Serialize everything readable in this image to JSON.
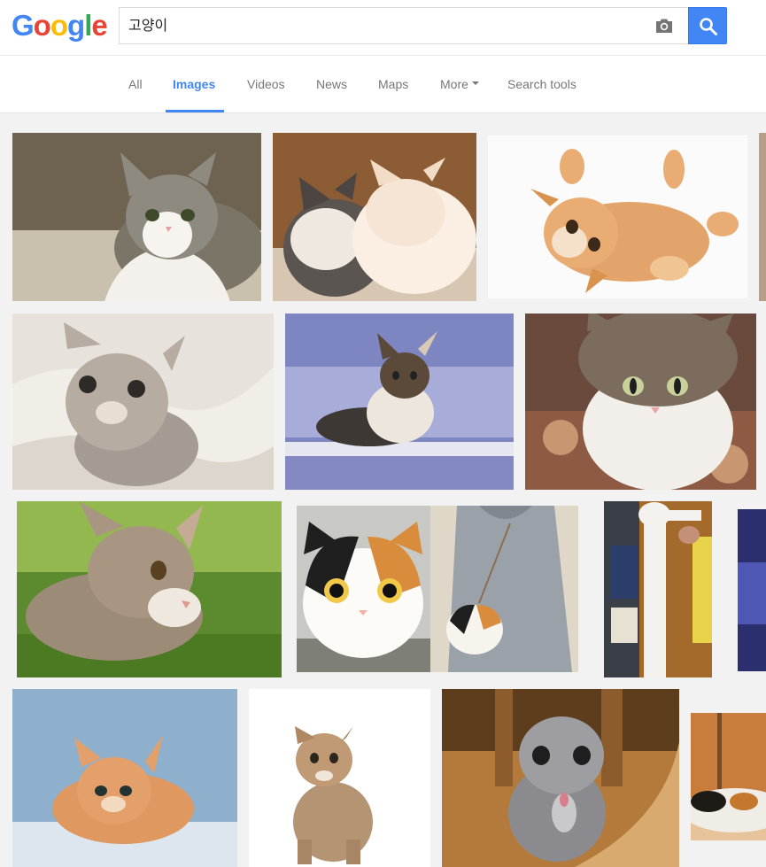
{
  "logo": {
    "letters": [
      "G",
      "o",
      "o",
      "g",
      "l",
      "e"
    ]
  },
  "search": {
    "query": "고양이",
    "camera_icon": "camera-icon",
    "search_icon": "magnifier-icon"
  },
  "tabs": [
    {
      "label": "All"
    },
    {
      "label": "Images"
    },
    {
      "label": "Videos"
    },
    {
      "label": "News"
    },
    {
      "label": "Maps"
    },
    {
      "label": "More"
    },
    {
      "label": "Search tools"
    }
  ],
  "colors": {
    "accent": "#4285f4",
    "header_bg": "#ffffff",
    "page_bg": "#f2f2f2"
  },
  "results": [
    {
      "id": "cat-1",
      "desc": "tabby-white cat lying on sofa"
    },
    {
      "id": "cat-2",
      "desc": "two fluffy kittens sleeping"
    },
    {
      "id": "cat-3",
      "desc": "orange kitten on back"
    },
    {
      "id": "cat-4",
      "desc": "grey kitten on blanket"
    },
    {
      "id": "cat-5",
      "desc": "calico kitten on blue bench"
    },
    {
      "id": "cat-6",
      "desc": "tabby-white cat on carpet"
    },
    {
      "id": "cat-7",
      "desc": "tabby kitten in grass"
    },
    {
      "id": "cat-8",
      "desc": "calico cat bag and hoodie"
    },
    {
      "id": "cat-9",
      "desc": "long cat held up"
    },
    {
      "id": "cat-10",
      "desc": "orange kitten on wood"
    },
    {
      "id": "cat-11",
      "desc": "tabby kitten sitting on white"
    },
    {
      "id": "cat-12",
      "desc": "grey scottish fold kitten"
    },
    {
      "id": "cat-13",
      "desc": "calico cat on floor"
    }
  ]
}
